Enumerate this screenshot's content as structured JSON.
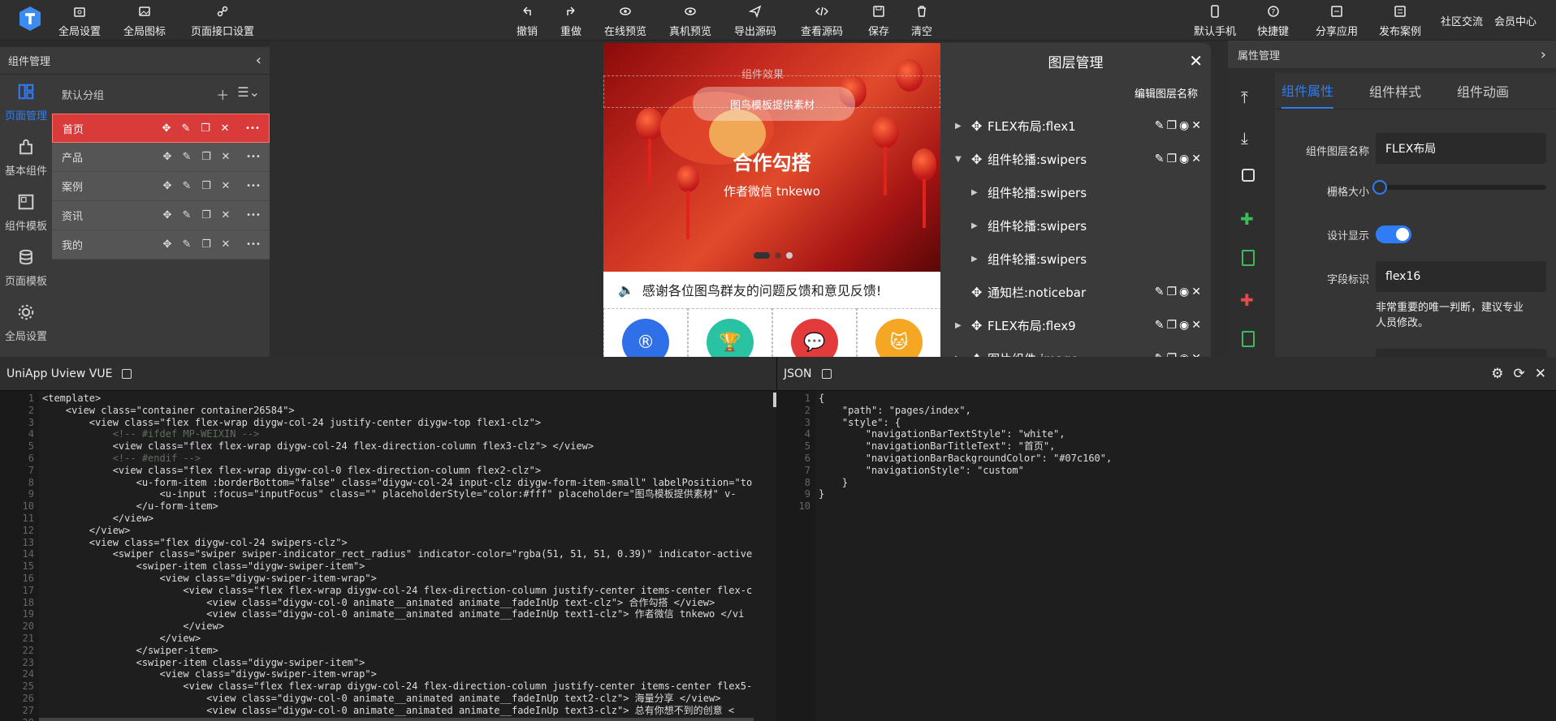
{
  "topbar": {
    "left": [
      {
        "label": "全局设置",
        "icon": "settings-icon"
      },
      {
        "label": "全局图标",
        "icon": "image-icon"
      },
      {
        "label": "页面接口设置",
        "icon": "api-icon"
      }
    ],
    "center": [
      {
        "label": "撤销",
        "icon": "undo-icon"
      },
      {
        "label": "重做",
        "icon": "redo-icon"
      },
      {
        "label": "在线预览",
        "icon": "eye-icon"
      },
      {
        "label": "真机预览",
        "icon": "eye-icon"
      },
      {
        "label": "导出源码",
        "icon": "send-icon"
      },
      {
        "label": "查看源码",
        "icon": "code-icon"
      },
      {
        "label": "保存",
        "icon": "save-icon"
      },
      {
        "label": "清空",
        "icon": "trash-icon"
      }
    ],
    "right": [
      {
        "label": "默认手机",
        "icon": "phone-icon"
      },
      {
        "label": "快捷键",
        "icon": "help-icon"
      },
      {
        "label": "分享应用",
        "icon": "share-icon"
      },
      {
        "label": "发布案例",
        "icon": "publish-icon"
      },
      {
        "label": "社区交流",
        "icon": ""
      },
      {
        "label": "会员中心",
        "icon": ""
      }
    ]
  },
  "left_panel": {
    "title": "组件管理",
    "nav": [
      {
        "label": "页面管理",
        "icon": "layout-icon",
        "active": true
      },
      {
        "label": "基本组件",
        "icon": "puzzle-icon"
      },
      {
        "label": "组件模板",
        "icon": "template-icon"
      },
      {
        "label": "页面模板",
        "icon": "database-icon"
      },
      {
        "label": "全局设置",
        "icon": "gear-icon"
      }
    ],
    "group": "默认分组",
    "pages": [
      "首页",
      "产品",
      "案例",
      "资讯",
      "我的"
    ]
  },
  "phone": {
    "search_hint": "组件效果",
    "search_placeholder": "图鸟模板提供素材",
    "banner_title": "合作勾搭",
    "banner_sub": "作者微信 tnkewo",
    "notice": "感谢各位图鸟群友的问题反馈和意见反馈!",
    "icon_colors": [
      "#2f6fe8",
      "#29c2a3",
      "#e33b3b",
      "#f5a623"
    ]
  },
  "layers": {
    "title": "图层管理",
    "edit_label": "编辑图层名称",
    "rows": [
      {
        "label": "FLEX布局:flex1",
        "depth": 0,
        "arrow": "right",
        "ops": true
      },
      {
        "label": "组件轮播:swipers",
        "depth": 0,
        "arrow": "down",
        "ops": true
      },
      {
        "label": "组件轮播:swipers",
        "depth": 1,
        "arrow": "right",
        "ops": false
      },
      {
        "label": "组件轮播:swipers",
        "depth": 1,
        "arrow": "right",
        "ops": false
      },
      {
        "label": "组件轮播:swipers",
        "depth": 1,
        "arrow": "right",
        "ops": false
      },
      {
        "label": "通知栏:noticebar",
        "depth": 0,
        "arrow": "",
        "ops": true
      },
      {
        "label": "FLEX布局:flex9",
        "depth": 0,
        "arrow": "right",
        "ops": true
      },
      {
        "label": "图片组件:image",
        "depth": 0,
        "arrow": "right",
        "ops": true
      }
    ]
  },
  "props": {
    "title": "属性管理",
    "tabs": [
      "组件属性",
      "组件样式",
      "组件动画"
    ],
    "layer_name_label": "组件图层名称",
    "layer_name_value": "FLEX布局",
    "grid_label": "栅格大小",
    "grid_value": 0,
    "design_label": "设计显示",
    "design_on": true,
    "field_label": "字段标识",
    "field_value": "flex16",
    "field_hint_1": "非常重要的唯一判断，建议专业",
    "field_hint_2": "人员修改。",
    "accent": "#2f7df6"
  },
  "editor_left": {
    "title": "UniApp Uview VUE",
    "lines": [
      "<template>",
      "    <view class=\"container container26584\">",
      "        <view class=\"flex flex-wrap diygw-col-24 justify-center diygw-top flex1-clz\">",
      "            <!-- #ifdef MP-WEIXIN -->",
      "            <view class=\"flex flex-wrap diygw-col-24 flex-direction-column flex3-clz\"> </view>",
      "            <!-- #endif -->",
      "            <view class=\"flex flex-wrap diygw-col-0 flex-direction-column flex2-clz\">",
      "                <u-form-item :borderBottom=\"false\" class=\"diygw-col-24 input-clz diygw-form-item-small\" labelPosition=\"to",
      "                    <u-input :focus=\"inputFocus\" class=\"\" placeholderStyle=\"color:#fff\" placeholder=\"图鸟模板提供素材\" v-",
      "                </u-form-item>",
      "            </view>",
      "        </view>",
      "        <view class=\"flex diygw-col-24 swipers-clz\">",
      "            <swiper class=\"swiper swiper-indicator_rect_radius\" indicator-color=\"rgba(51, 51, 51, 0.39)\" indicator-active",
      "                <swiper-item class=\"diygw-swiper-item\">",
      "                    <view class=\"diygw-swiper-item-wrap\">",
      "                        <view class=\"flex flex-wrap diygw-col-24 flex-direction-column justify-center items-center flex-c",
      "                            <view class=\"diygw-col-0 animate__animated animate__fadeInUp text-clz\"> 合作勾搭 </view>",
      "                            <view class=\"diygw-col-0 animate__animated animate__fadeInUp text1-clz\"> 作者微信 tnkewo </vi",
      "                        </view>",
      "                    </view>",
      "                </swiper-item>",
      "                <swiper-item class=\"diygw-swiper-item\">",
      "                    <view class=\"diygw-swiper-item-wrap\">",
      "                        <view class=\"flex flex-wrap diygw-col-24 flex-direction-column justify-center items-center flex5-",
      "                            <view class=\"diygw-col-0 animate__animated animate__fadeInUp text2-clz\"> 海量分享 </view>",
      "                            <view class=\"diygw-col-0 animate__animated animate__fadeInUp text3-clz\"> 总有你想不到的创意 <",
      "                        </view>"
    ]
  },
  "editor_right": {
    "title": "JSON",
    "lines": [
      "{",
      "    \"path\": \"pages/index\",",
      "    \"style\": {",
      "        \"navigationBarTextStyle\": \"white\",",
      "        \"navigationBarTitleText\": \"首页\",",
      "        \"navigationBarBackgroundColor\": \"#07c160\",",
      "        \"navigationStyle\": \"custom\"",
      "    }",
      "}",
      ""
    ]
  }
}
